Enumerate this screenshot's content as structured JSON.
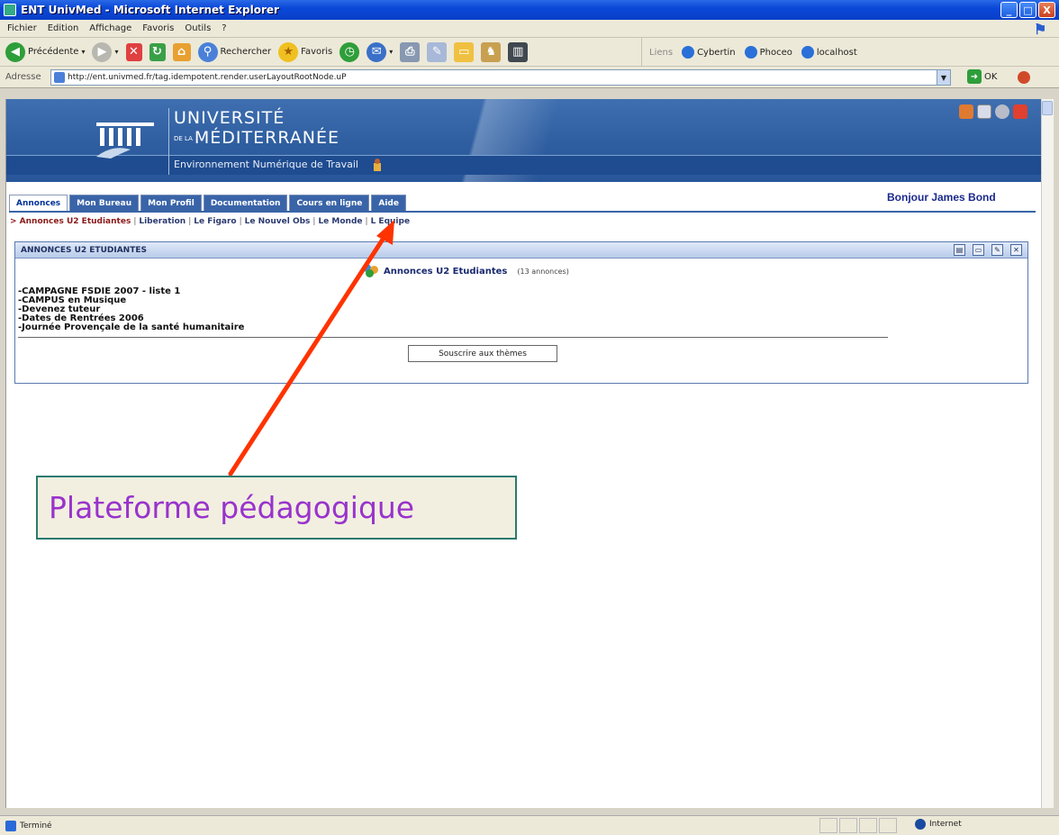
{
  "window": {
    "title": "ENT UnivMed - Microsoft Internet Explorer",
    "controls": [
      "_",
      "□",
      "X"
    ]
  },
  "menu": [
    "Fichier",
    "Edition",
    "Affichage",
    "Favoris",
    "Outils",
    "?"
  ],
  "toolbar": {
    "back_label": "Précédente",
    "search_label": "Rechercher",
    "favorites_label": "Favoris",
    "links_label": "Liens",
    "links": [
      "Cybertin",
      "Phoceo",
      "localhost"
    ]
  },
  "address": {
    "label": "Adresse",
    "url": "http://ent.univmed.fr/tag.idempotent.render.userLayoutRootNode.uP",
    "go_label": "OK"
  },
  "banner": {
    "line1": "UNIVERSITÉ",
    "prefix": "DE LA",
    "line2": "MÉDITERRANÉE",
    "subtitle": "Environnement Numérique de Travail"
  },
  "tabs": [
    {
      "label": "Annonces",
      "active": true
    },
    {
      "label": "Mon Bureau",
      "active": false
    },
    {
      "label": "Mon Profil",
      "active": false
    },
    {
      "label": "Documentation",
      "active": false
    },
    {
      "label": "Cours en ligne",
      "active": false
    },
    {
      "label": "Aide",
      "active": false
    }
  ],
  "greeting": "Bonjour James Bond",
  "subnav": {
    "first": "> Annonces U2 Etudiantes",
    "items": [
      "Liberation",
      "Le Figaro",
      "Le Nouvel Obs",
      "Le Monde",
      "L Equipe"
    ]
  },
  "channel": {
    "header": "ANNONCES U2 ETUDIANTES",
    "feed_title": "Annonces U2 Etudiantes",
    "feed_count": "(13 annonces)",
    "items": [
      "CAMPAGNE FSDIE 2007 - liste 1",
      "CAMPUS en Musique",
      "Devenez tuteur",
      "Dates de Rentrées 2006",
      "Journée Provençale de la santé humanitaire"
    ],
    "subscribe_label": "Souscrire aux thèmes"
  },
  "callout": "Plateforme pédagogique",
  "status": {
    "left": "Terminé",
    "zone": "Internet"
  },
  "colors": {
    "title_bar": "#0a48d8",
    "banner": "#2f5ea0",
    "tab": "#3a64a8",
    "arrow": "#ff3300",
    "callout_text": "#9933cc",
    "greeting": "#1a2a8c"
  }
}
